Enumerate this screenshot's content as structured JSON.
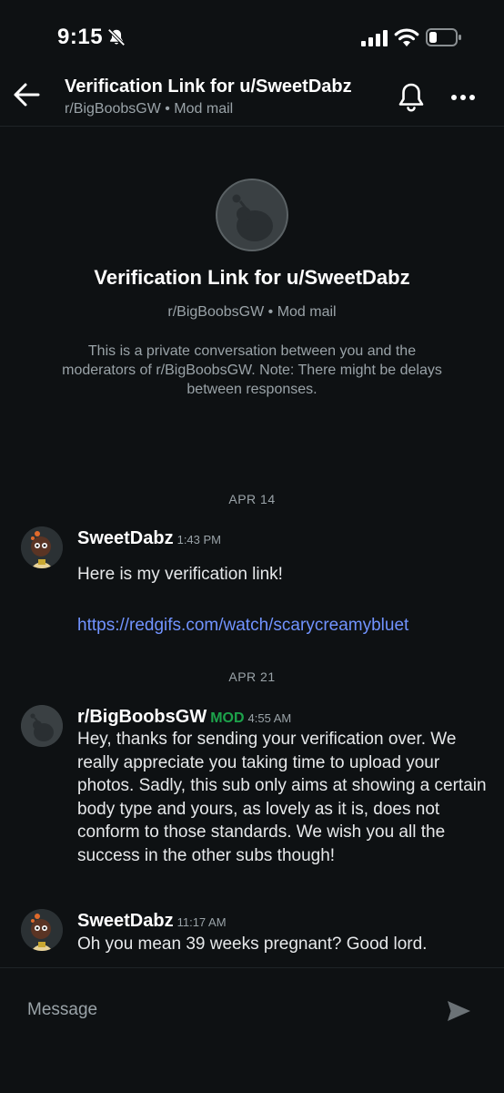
{
  "status_bar": {
    "time": "9:15"
  },
  "header": {
    "title": "Verification Link for u/SweetDabz",
    "subtitle": "r/BigBoobsGW • Mod mail"
  },
  "intro": {
    "title": "Verification Link for u/SweetDabz",
    "subtitle": "r/BigBoobsGW • Mod mail",
    "note": "This is a private conversation between you and the moderators of r/BigBoobsGW. Note: There might be delays between responses."
  },
  "dates": [
    "APR 14",
    "APR 21"
  ],
  "messages": [
    {
      "author": "SweetDabz",
      "time": "1:43 PM",
      "text": "Here is my verification link!",
      "link": "https://redgifs.com/watch/scarycreamybluet"
    },
    {
      "author": "r/BigBoobsGW",
      "badge": "MOD",
      "time": "4:55 AM",
      "text": "Hey, thanks for sending your verification over. We really appreciate you taking time to upload your photos. Sadly, this sub only aims at showing a certain body type and yours, as lovely as it is, does not conform to those standards. We wish you all the success in the other subs though!"
    },
    {
      "author": "SweetDabz",
      "time": "11:17 AM",
      "text": "Oh you mean 39 weeks pregnant? Good lord."
    }
  ],
  "composer": {
    "placeholder": "Message"
  },
  "icons": {
    "status": [
      "bell-slash-icon",
      "cellular-signal-icon",
      "wifi-icon",
      "battery-icon"
    ],
    "header": [
      "back-arrow-icon",
      "bell-icon",
      "more-horizontal-icon"
    ],
    "composer": [
      "send-icon"
    ]
  },
  "colors": {
    "background": "#0e1113",
    "link": "#7193ff",
    "mod_badge": "#1da34b",
    "secondary_text": "#9aa3a8"
  }
}
